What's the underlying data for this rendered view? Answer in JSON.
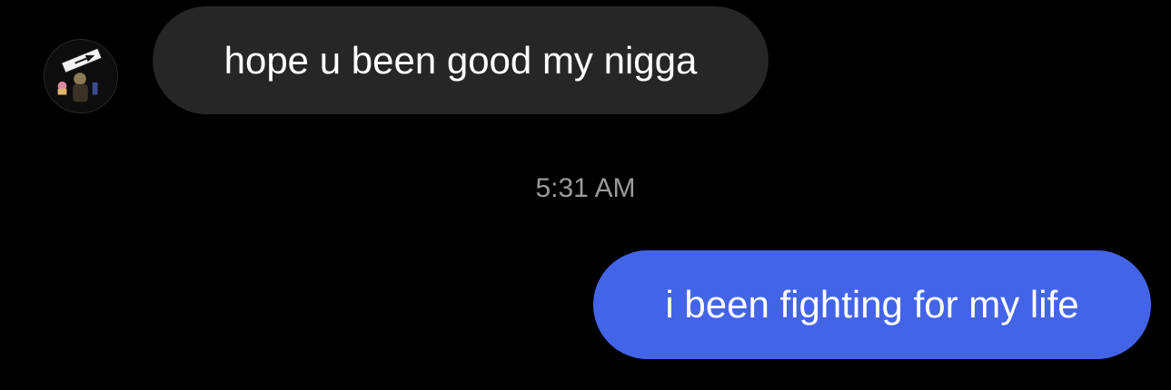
{
  "conversation": {
    "messages": [
      {
        "direction": "incoming",
        "text": "hope u been good my nigga",
        "sender_avatar_icon": "profile-avatar",
        "avatar_sign_text": "ONE WAY"
      },
      {
        "direction": "outgoing",
        "text": "i been fighting for my life"
      }
    ],
    "timestamp": "5:31 AM"
  },
  "colors": {
    "background": "#000000",
    "incoming_bubble": "#262626",
    "outgoing_bubble": "#4464e8",
    "timestamp_text": "#9a9a9a",
    "message_text": "#ffffff"
  }
}
